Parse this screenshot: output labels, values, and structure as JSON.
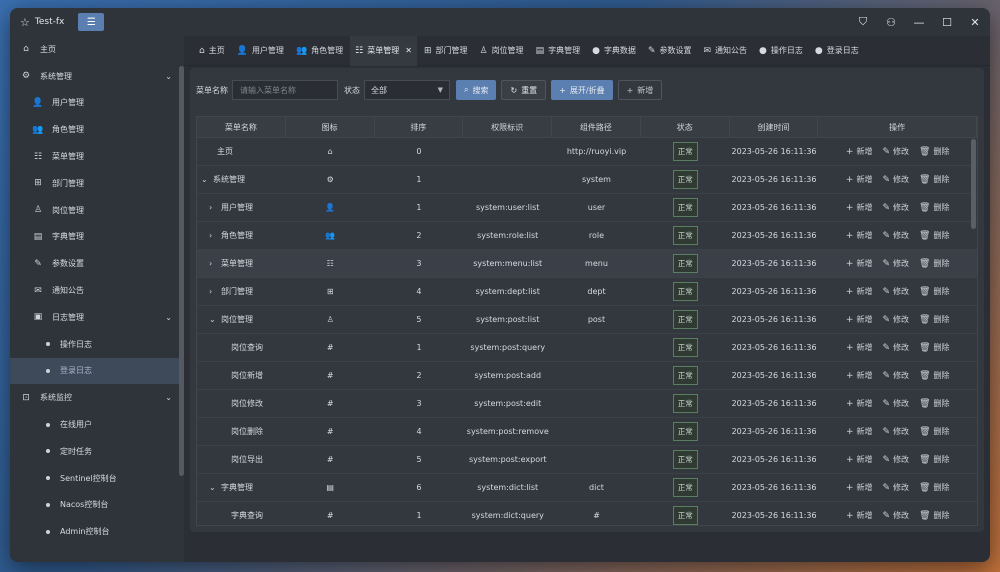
{
  "window": {
    "title": "Test-fx",
    "menu_toggle_icon": "☰"
  },
  "win_controls": [
    "shirt-icon",
    "user-icon",
    "minimize-icon",
    "maximize-icon",
    "close-icon"
  ],
  "sidebar": {
    "items": [
      {
        "label": "主页",
        "icon": "⌂",
        "level": 0
      },
      {
        "label": "系统管理",
        "icon": "⚙",
        "level": 0,
        "expanded": true
      },
      {
        "label": "用户管理",
        "icon": "👤",
        "level": 1
      },
      {
        "label": "角色管理",
        "icon": "👥",
        "level": 1
      },
      {
        "label": "菜单管理",
        "icon": "☷",
        "level": 1
      },
      {
        "label": "部门管理",
        "icon": "⊞",
        "level": 1
      },
      {
        "label": "岗位管理",
        "icon": "♙",
        "level": 1
      },
      {
        "label": "字典管理",
        "icon": "▤",
        "level": 1
      },
      {
        "label": "参数设置",
        "icon": "✎",
        "level": 1
      },
      {
        "label": "通知公告",
        "icon": "✉",
        "level": 1
      },
      {
        "label": "日志管理",
        "icon": "▣",
        "level": 1,
        "expanded": true
      },
      {
        "label": "操作日志",
        "level": 2
      },
      {
        "label": "登录日志",
        "level": 2,
        "active": true
      },
      {
        "label": "系统监控",
        "icon": "⊡",
        "level": 0,
        "expanded": true
      },
      {
        "label": "在线用户",
        "level": 2
      },
      {
        "label": "定时任务",
        "level": 2
      },
      {
        "label": "Sentinel控制台",
        "level": 2
      },
      {
        "label": "Nacos控制台",
        "level": 2
      },
      {
        "label": "Admin控制台",
        "level": 2
      }
    ]
  },
  "tabs": [
    {
      "label": "主页",
      "icon": "⌂"
    },
    {
      "label": "用户管理",
      "icon": "👤"
    },
    {
      "label": "角色管理",
      "icon": "👥"
    },
    {
      "label": "菜单管理",
      "icon": "☷",
      "active": true,
      "closable": true
    },
    {
      "label": "部门管理",
      "icon": "⊞"
    },
    {
      "label": "岗位管理",
      "icon": "♙"
    },
    {
      "label": "字典管理",
      "icon": "▤"
    },
    {
      "label": "字典数据",
      "icon": "●"
    },
    {
      "label": "参数设置",
      "icon": "✎"
    },
    {
      "label": "通知公告",
      "icon": "✉"
    },
    {
      "label": "操作日志",
      "icon": "●"
    },
    {
      "label": "登录日志",
      "icon": "●"
    }
  ],
  "search": {
    "name_label": "菜单名称",
    "name_placeholder": "请输入菜单名称",
    "status_label": "状态",
    "status_value": "全部",
    "search_btn": "搜索",
    "reset_btn": "重置",
    "expand_btn": "展开/折叠",
    "add_btn": "新增"
  },
  "table": {
    "headers": [
      "菜单名称",
      "图标",
      "排序",
      "权限标识",
      "组件路径",
      "状态",
      "创建时间",
      "操作"
    ],
    "op_labels": {
      "add": "新增",
      "edit": "修改",
      "delete": "删除"
    },
    "rows": [
      {
        "name": "主页",
        "indent": 0,
        "caret": "",
        "icon": "⌂",
        "order": "0",
        "perm": "",
        "path": "http://ruoyi.vip",
        "status": "正常",
        "time": "2023-05-26 16:11:36"
      },
      {
        "name": "系统管理",
        "indent": 0,
        "caret": "⌄",
        "icon": "⚙",
        "order": "1",
        "perm": "",
        "path": "system",
        "status": "正常",
        "time": "2023-05-26 16:11:36"
      },
      {
        "name": "用户管理",
        "indent": 1,
        "caret": "›",
        "icon": "👤",
        "order": "1",
        "perm": "system:user:list",
        "path": "user",
        "status": "正常",
        "time": "2023-05-26 16:11:36"
      },
      {
        "name": "角色管理",
        "indent": 1,
        "caret": "›",
        "icon": "👥",
        "order": "2",
        "perm": "system:role:list",
        "path": "role",
        "status": "正常",
        "time": "2023-05-26 16:11:36"
      },
      {
        "name": "菜单管理",
        "indent": 1,
        "caret": "›",
        "icon": "☷",
        "order": "3",
        "perm": "system:menu:list",
        "path": "menu",
        "status": "正常",
        "time": "2023-05-26 16:11:36",
        "highlight": true
      },
      {
        "name": "部门管理",
        "indent": 1,
        "caret": "›",
        "icon": "⊞",
        "order": "4",
        "perm": "system:dept:list",
        "path": "dept",
        "status": "正常",
        "time": "2023-05-26 16:11:36"
      },
      {
        "name": "岗位管理",
        "indent": 1,
        "caret": "⌄",
        "icon": "♙",
        "order": "5",
        "perm": "system:post:list",
        "path": "post",
        "status": "正常",
        "time": "2023-05-26 16:11:36"
      },
      {
        "name": "岗位查询",
        "indent": 2,
        "caret": "",
        "icon": "#",
        "order": "1",
        "perm": "system:post:query",
        "path": "",
        "status": "正常",
        "time": "2023-05-26 16:11:36"
      },
      {
        "name": "岗位新增",
        "indent": 2,
        "caret": "",
        "icon": "#",
        "order": "2",
        "perm": "system:post:add",
        "path": "",
        "status": "正常",
        "time": "2023-05-26 16:11:36"
      },
      {
        "name": "岗位修改",
        "indent": 2,
        "caret": "",
        "icon": "#",
        "order": "3",
        "perm": "system:post:edit",
        "path": "",
        "status": "正常",
        "time": "2023-05-26 16:11:36"
      },
      {
        "name": "岗位删除",
        "indent": 2,
        "caret": "",
        "icon": "#",
        "order": "4",
        "perm": "system:post:remove",
        "path": "",
        "status": "正常",
        "time": "2023-05-26 16:11:36"
      },
      {
        "name": "岗位导出",
        "indent": 2,
        "caret": "",
        "icon": "#",
        "order": "5",
        "perm": "system:post:export",
        "path": "",
        "status": "正常",
        "time": "2023-05-26 16:11:36"
      },
      {
        "name": "字典管理",
        "indent": 1,
        "caret": "⌄",
        "icon": "▤",
        "order": "6",
        "perm": "system:dict:list",
        "path": "dict",
        "status": "正常",
        "time": "2023-05-26 16:11:36"
      },
      {
        "name": "字典查询",
        "indent": 2,
        "caret": "",
        "icon": "#",
        "order": "1",
        "perm": "system:dict:query",
        "path": "#",
        "status": "正常",
        "time": "2023-05-26 16:11:36"
      }
    ]
  }
}
